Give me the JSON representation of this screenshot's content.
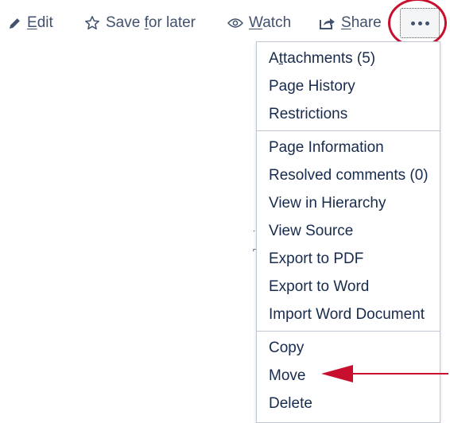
{
  "toolbar": {
    "edit": {
      "label": "Edit",
      "icon": "pencil-icon",
      "underline": "E",
      "rest": "dit"
    },
    "save_for_later": {
      "label": "Save for later",
      "icon": "star-outline-icon",
      "pre": "Save ",
      "underline": "f",
      "rest": "or later"
    },
    "watch": {
      "label": "Watch",
      "icon": "eye-icon",
      "underline": "W",
      "rest": "atch"
    },
    "share": {
      "label": "Share",
      "icon": "share-icon",
      "underline": "S",
      "rest": "hare"
    },
    "more": {
      "icon": "ellipsis-icon"
    }
  },
  "menu": {
    "groups": [
      {
        "items": [
          {
            "label": "Attachments (5)",
            "pre": "A",
            "underline": "t",
            "rest": "tachments (5)"
          },
          {
            "label": "Page History"
          },
          {
            "label": "Restrictions"
          }
        ]
      },
      {
        "items": [
          {
            "label": "Page Information"
          },
          {
            "label": "Resolved comments (0)"
          },
          {
            "label": "View in Hierarchy"
          },
          {
            "label": "View Source"
          },
          {
            "label": "Export to PDF"
          },
          {
            "label": "Export to Word"
          },
          {
            "label": "Import Word Document"
          }
        ]
      },
      {
        "items": [
          {
            "label": "Copy"
          },
          {
            "label": "Move"
          },
          {
            "label": "Delete"
          }
        ]
      }
    ]
  },
  "annotations": {
    "color": "#c8102e"
  },
  "colors": {
    "toolbar_text": "#42526e",
    "menu_text": "#172b4d",
    "menu_border": "#c1c7d0"
  }
}
